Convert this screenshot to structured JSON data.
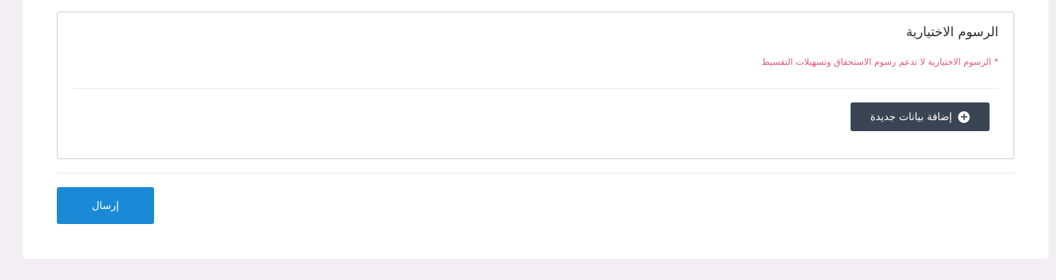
{
  "fees_section": {
    "title": "الرسوم الاختيارية",
    "note": "* الرسوم الاختيارية لا تدعم رسوم الاستحقاق وتسهيلات التقسيط",
    "add_button_label": "إضافة بيانات جديدة",
    "add_button_icon": "plus-circle-icon"
  },
  "form": {
    "submit_label": "إرسال"
  },
  "colors": {
    "note": "#e8587a",
    "add_button_bg": "#3a4452",
    "submit_button_bg": "#1a8ad6",
    "page_background": "#f2eef4"
  }
}
